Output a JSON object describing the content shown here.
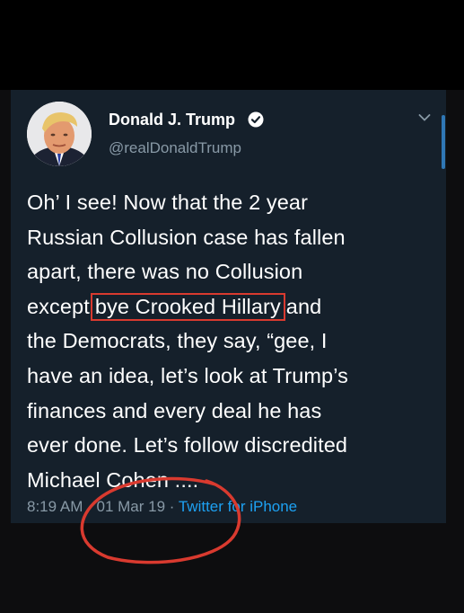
{
  "tweet": {
    "author_name": "Donald J. Trump",
    "author_handle": "@realDonaldTrump",
    "lines": [
      "Oh’ I see! Now that the 2 year",
      "Russian Collusion case has fallen",
      "apart, there was no Collusion",
      "the Democrats, they say, “gee, I",
      "have an idea, let’s look at Trump’s",
      "finances and every deal he has",
      "ever done. Let’s follow discredited",
      "Michael Cohen ...."
    ],
    "highlight_line": {
      "before": "except",
      "highlighted": "bye Crooked Hillary",
      "after": "and"
    },
    "meta": {
      "time": "8:19 AM",
      "separator": "·",
      "date": "01 Mar 19",
      "source": "Twitter for iPhone"
    }
  },
  "colors": {
    "background": "#15202b",
    "text": "#ffffff",
    "secondary_text": "#8899a6",
    "link": "#1da1f2",
    "annotation_red": "#d93a2f",
    "verified_badge": "#ffffff"
  },
  "icons": {
    "verified": "verified-badge-icon",
    "menu": "chevron-down-icon"
  }
}
